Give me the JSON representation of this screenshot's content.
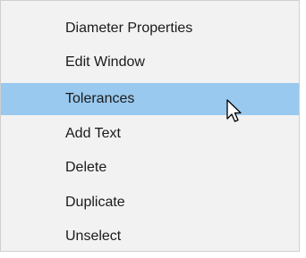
{
  "context_menu": {
    "items": [
      {
        "label": "Diameter Properties",
        "highlighted": false
      },
      {
        "label": "Edit Window",
        "highlighted": false
      },
      {
        "label": "Tolerances",
        "highlighted": true
      },
      {
        "label": "Add Text",
        "highlighted": false
      },
      {
        "label": "Delete",
        "highlighted": false
      },
      {
        "label": "Duplicate",
        "highlighted": false
      },
      {
        "label": "Unselect",
        "highlighted": false
      }
    ]
  },
  "colors": {
    "menu_background": "#f2f2f2",
    "highlight": "#99c9ef",
    "text": "#1a1a1a"
  },
  "cursor": {
    "icon": "mouse-pointer-icon"
  }
}
